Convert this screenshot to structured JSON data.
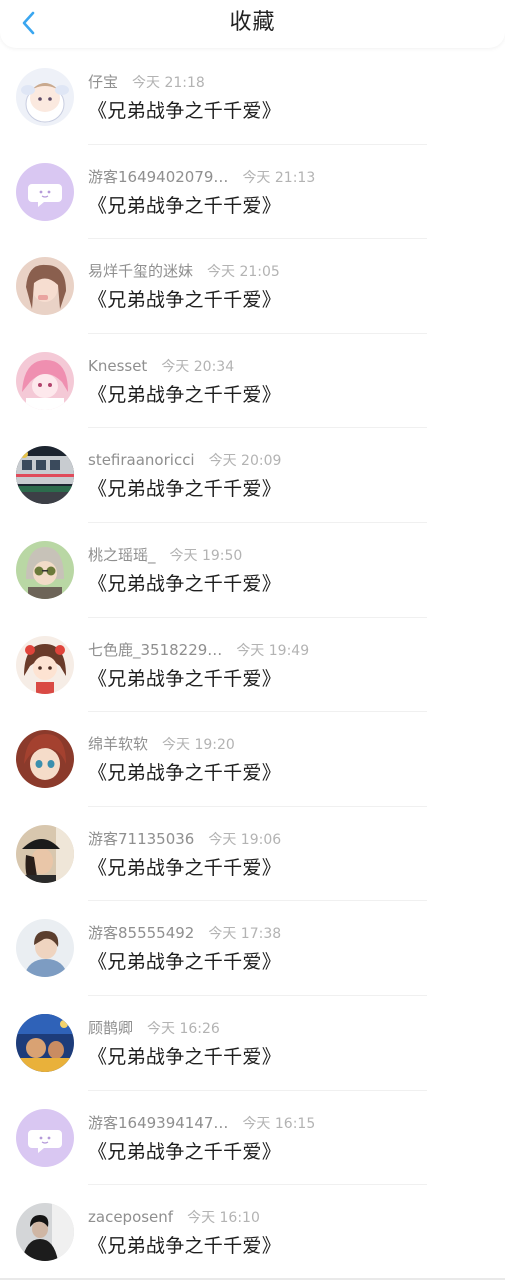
{
  "header": {
    "title": "收藏",
    "back_icon": "chevron-left-icon",
    "accent": "#3aa6f0"
  },
  "items": [
    {
      "user": "仔宝",
      "time": "今天 21:18",
      "book": "《兄弟战争之千千爱》",
      "avatar": "anime-sheep-icon"
    },
    {
      "user": "游客1649402079…",
      "time": "今天 21:13",
      "book": "《兄弟战争之千千爱》",
      "avatar": "chat-bubble-icon"
    },
    {
      "user": "易烊千玺的迷妹",
      "time": "今天 21:05",
      "book": "《兄弟战争之千千爱》",
      "avatar": "photo-avatar-icon"
    },
    {
      "user": "Knesset",
      "time": "今天 20:34",
      "book": "《兄弟战争之千千爱》",
      "avatar": "anime-pink-icon"
    },
    {
      "user": "stefiraanoricci",
      "time": "今天 20:09",
      "book": "《兄弟战争之千千爱》",
      "avatar": "train-photo-icon"
    },
    {
      "user": "桃之瑶瑶_",
      "time": "今天 19:50",
      "book": "《兄弟战争之千千爱》",
      "avatar": "anime-glasses-icon"
    },
    {
      "user": "七色鹿_3518229…",
      "time": "今天 19:49",
      "book": "《兄弟战争之千千爱》",
      "avatar": "anime-girl-icon"
    },
    {
      "user": "绵羊软软",
      "time": "今天 19:20",
      "book": "《兄弟战争之千千爱》",
      "avatar": "anime-redhair-icon"
    },
    {
      "user": "游客71135036",
      "time": "今天 19:06",
      "book": "《兄弟战争之千千爱》",
      "avatar": "photo-hat-icon"
    },
    {
      "user": "游客85555492",
      "time": "今天 17:38",
      "book": "《兄弟战争之千千爱》",
      "avatar": "photo-child-icon"
    },
    {
      "user": "顾鹊卿",
      "time": "今天 16:26",
      "book": "《兄弟战争之千千爱》",
      "avatar": "photo-scene-icon"
    },
    {
      "user": "游客1649394147…",
      "time": "今天 16:15",
      "book": "《兄弟战争之千千爱》",
      "avatar": "chat-bubble-icon"
    },
    {
      "user": "zaceposenf",
      "time": "今天 16:10",
      "book": "《兄弟战争之千千爱》",
      "avatar": "photo-dark-icon"
    }
  ]
}
